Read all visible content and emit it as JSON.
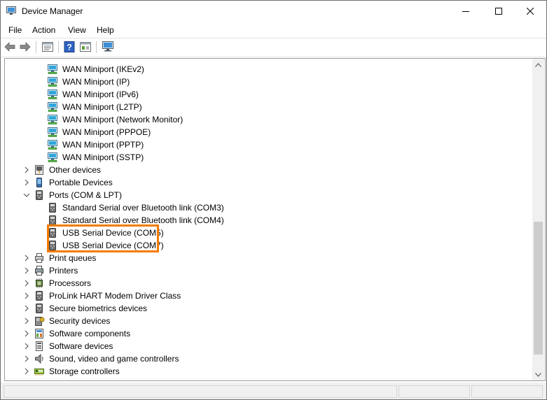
{
  "window": {
    "title": "Device Manager"
  },
  "menu": [
    "File",
    "Action",
    "View",
    "Help"
  ],
  "toolbar": {
    "buttons": [
      "back-icon",
      "forward-icon",
      "properties-icon",
      "help-icon",
      "update-driver-icon",
      "scan-hardware-icon"
    ]
  },
  "tree": {
    "rows": [
      {
        "label": "WAN Miniport (IKEv2)",
        "icon": "network-adapter-icon",
        "level": 2,
        "expander": ""
      },
      {
        "label": "WAN Miniport (IP)",
        "icon": "network-adapter-icon",
        "level": 2,
        "expander": ""
      },
      {
        "label": "WAN Miniport (IPv6)",
        "icon": "network-adapter-icon",
        "level": 2,
        "expander": ""
      },
      {
        "label": "WAN Miniport (L2TP)",
        "icon": "network-adapter-icon",
        "level": 2,
        "expander": ""
      },
      {
        "label": "WAN Miniport (Network Monitor)",
        "icon": "network-adapter-icon",
        "level": 2,
        "expander": ""
      },
      {
        "label": "WAN Miniport (PPPOE)",
        "icon": "network-adapter-icon",
        "level": 2,
        "expander": ""
      },
      {
        "label": "WAN Miniport (PPTP)",
        "icon": "network-adapter-icon",
        "level": 2,
        "expander": ""
      },
      {
        "label": "WAN Miniport (SSTP)",
        "icon": "network-adapter-icon",
        "level": 2,
        "expander": ""
      },
      {
        "label": "Other devices",
        "icon": "unknown-device-icon",
        "level": 1,
        "expander": "collapsed"
      },
      {
        "label": "Portable Devices",
        "icon": "portable-device-icon",
        "level": 1,
        "expander": "collapsed"
      },
      {
        "label": "Ports (COM & LPT)",
        "icon": "port-icon",
        "level": 1,
        "expander": "expanded"
      },
      {
        "label": "Standard Serial over Bluetooth link (COM3)",
        "icon": "port-icon",
        "level": 2,
        "expander": ""
      },
      {
        "label": "Standard Serial over Bluetooth link (COM4)",
        "icon": "port-icon",
        "level": 2,
        "expander": ""
      },
      {
        "label": "USB Serial Device (COM5)",
        "icon": "port-icon",
        "level": 2,
        "expander": ""
      },
      {
        "label": "USB Serial Device (COM7)",
        "icon": "port-icon",
        "level": 2,
        "expander": ""
      },
      {
        "label": "Print queues",
        "icon": "print-queue-icon",
        "level": 1,
        "expander": "collapsed"
      },
      {
        "label": "Printers",
        "icon": "printer-icon",
        "level": 1,
        "expander": "collapsed"
      },
      {
        "label": "Processors",
        "icon": "processor-icon",
        "level": 1,
        "expander": "collapsed"
      },
      {
        "label": "ProLink HART Modem Driver Class",
        "icon": "port-icon",
        "level": 1,
        "expander": "collapsed"
      },
      {
        "label": "Secure biometrics devices",
        "icon": "port-icon",
        "level": 1,
        "expander": "collapsed"
      },
      {
        "label": "Security devices",
        "icon": "security-device-icon",
        "level": 1,
        "expander": "collapsed"
      },
      {
        "label": "Software components",
        "icon": "software-component-icon",
        "level": 1,
        "expander": "collapsed"
      },
      {
        "label": "Software devices",
        "icon": "software-device-icon",
        "level": 1,
        "expander": "collapsed"
      },
      {
        "label": "Sound, video and game controllers",
        "icon": "speaker-icon",
        "level": 1,
        "expander": "collapsed"
      },
      {
        "label": "Storage controllers",
        "icon": "storage-controller-icon",
        "level": 1,
        "expander": "collapsed"
      }
    ]
  },
  "colors": {
    "highlight": "#f57c00",
    "accent": "#1e7fd8"
  }
}
